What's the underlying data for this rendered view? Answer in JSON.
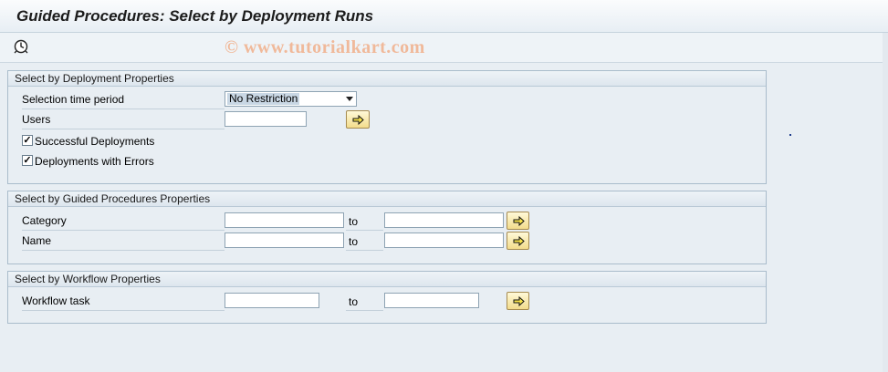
{
  "window": {
    "title": "Guided Procedures: Select by Deployment Runs"
  },
  "toolbar": {
    "execute_icon": "clock-execute-icon"
  },
  "watermark": "© www.tutorialkart.com",
  "deployment_group": {
    "title": "Select by Deployment Properties",
    "time_period_label": "Selection time period",
    "time_period_value": "No Restriction",
    "users_label": "Users",
    "users_value": "",
    "successful_label": "Successful Deployments",
    "successful_checked": true,
    "errors_label": "Deployments with Errors",
    "errors_checked": true
  },
  "gp_group": {
    "title": "Select by Guided Procedures Properties",
    "category_label": "Category",
    "category_from": "",
    "category_to": "",
    "name_label": "Name",
    "name_from": "",
    "name_to": "",
    "to_label": "to"
  },
  "wf_group": {
    "title": "Select by Workflow Properties",
    "task_label": "Workflow task",
    "task_from": "",
    "task_to": "",
    "to_label": "to"
  }
}
